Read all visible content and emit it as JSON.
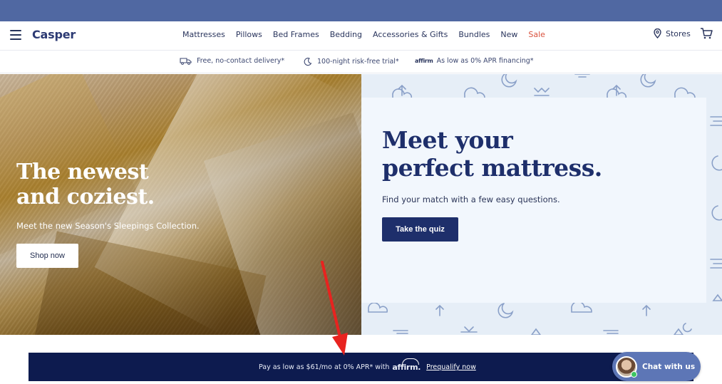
{
  "nav": {
    "logo": "Casper",
    "items": [
      "Mattresses",
      "Pillows",
      "Bed Frames",
      "Bedding",
      "Accessories & Gifts",
      "Bundles",
      "New",
      "Sale"
    ],
    "stores": "Stores",
    "sale_color": "#d9513d"
  },
  "perks": {
    "delivery": "Free, no-contact delivery*",
    "trial": "100-night risk-free trial*",
    "affirm_logo": "affirm",
    "financing": "As low as 0% APR financing*"
  },
  "hero_left": {
    "title_line1": "The newest",
    "title_line2": "and coziest.",
    "subtitle": "Meet the new Season's Sleepings Collection.",
    "button": "Shop now"
  },
  "hero_right": {
    "title_line1": "Meet your",
    "title_line2": "perfect mattress.",
    "subtitle": "Find your match with a few easy questions.",
    "button": "Take the quiz"
  },
  "affirm_banner": {
    "text": "Pay as low as $61/mo at 0% APR* with",
    "brand": "affirm.",
    "link": "Prequalify now"
  },
  "chat": {
    "label": "Chat with us"
  },
  "colors": {
    "brand_navy": "#1e2f6b",
    "top_band": "#5068a2",
    "banner": "#0d1b4f",
    "annotation_arrow": "#e8231f"
  },
  "icons": [
    "hamburger-icon",
    "location-pin-icon",
    "cart-icon",
    "truck-icon",
    "moon-icon",
    "chat-avatar"
  ]
}
